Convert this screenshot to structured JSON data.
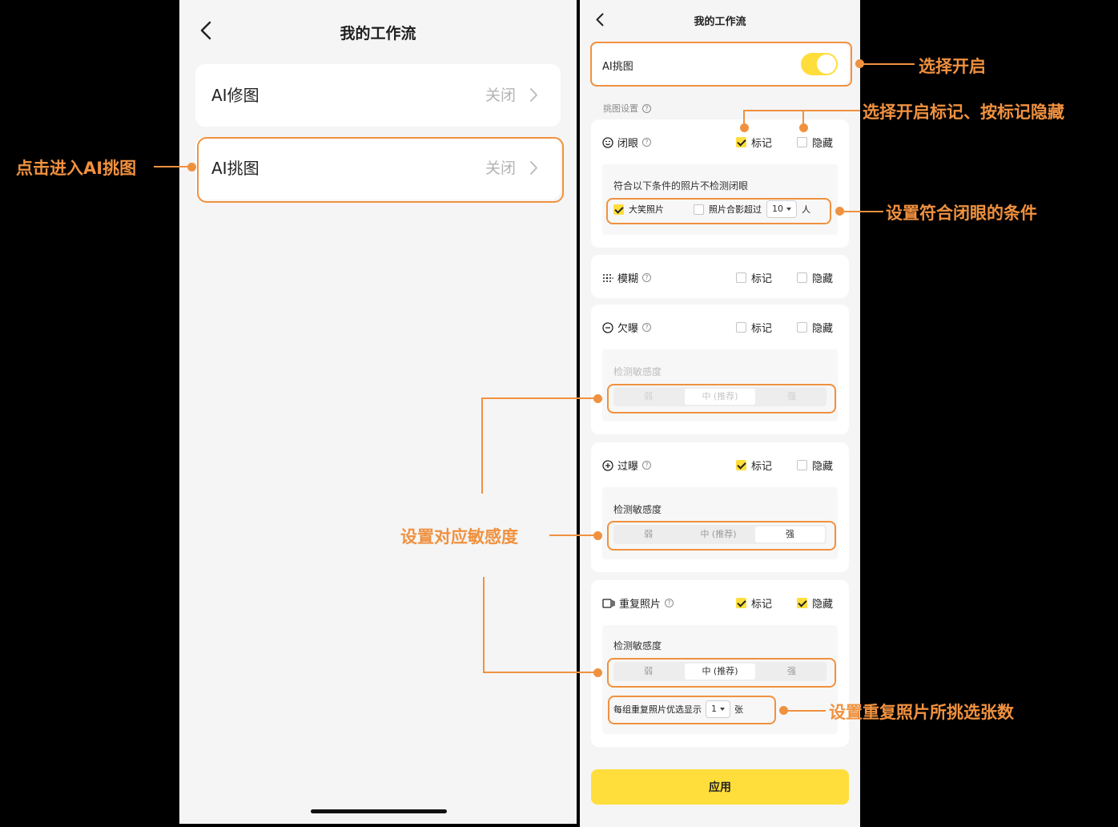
{
  "left": {
    "title": "我的工作流",
    "items": [
      {
        "label": "AI修图",
        "value": "关闭"
      },
      {
        "label": "AI挑图",
        "value": "关闭"
      }
    ]
  },
  "right": {
    "title": "我的工作流",
    "ai_pick_label": "AI挑图",
    "ai_pick_on": true,
    "settings_label": "挑图设置",
    "mark_label": "标记",
    "hide_label": "隐藏",
    "help_glyph": "?",
    "closed_eyes": {
      "label": "闭眼",
      "mark": true,
      "hide": false,
      "condition_title": "符合以下条件的照片不检测闭眼",
      "smile_label": "大笑照片",
      "smile": true,
      "group_label": "照片合影超过",
      "group": false,
      "group_count": "10",
      "group_unit": "人"
    },
    "blur": {
      "label": "模糊",
      "mark": false,
      "hide": false
    },
    "under": {
      "label": "欠曝",
      "mark": false,
      "hide": false
    },
    "over": {
      "label": "过曝",
      "mark": true,
      "hide": false
    },
    "duplicate": {
      "label": "重复照片",
      "mark": true,
      "hide": true,
      "show_label": "每组重复照片优选显示",
      "show_count": "1",
      "show_unit": "张"
    },
    "sensitivity_title": "检测敏感度",
    "sensitivity_options": [
      "弱",
      "中 (推荐)",
      "强"
    ],
    "under_selected": "中 (推荐)",
    "over_selected": "强",
    "dup_selected": "中 (推荐)",
    "apply_label": "应用"
  },
  "annotations": {
    "enter_ai_pick": "点击进入AI挑图",
    "select_on": "选择开启",
    "mark_hide": "选择开启标记、按标记隐藏",
    "closed_eye_condition": "设置符合闭眼的条件",
    "sensitivity": "设置对应敏感度",
    "dup_count": "设置重复照片所挑选张数"
  },
  "colors": {
    "accent": "#ffde3b",
    "annotation": "#f0913f",
    "background": "#f5f5f5"
  }
}
